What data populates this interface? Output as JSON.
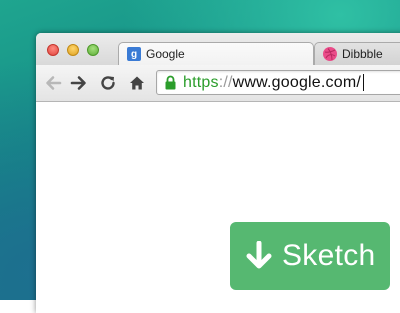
{
  "browser": {
    "tabs": [
      {
        "label": "Google",
        "icon": "google-favicon",
        "active": true
      },
      {
        "label": "Dibbble",
        "icon": "dribbble-favicon",
        "active": false
      }
    ],
    "toolbar": {
      "back_icon": "back-arrow-icon",
      "forward_icon": "forward-arrow-icon",
      "reload_icon": "reload-icon",
      "home_icon": "home-icon"
    },
    "address": {
      "scheme": "https",
      "separator": "://",
      "host": "www.google.com/",
      "secure_icon": "lock-icon",
      "secure_color": "#2b9d2b"
    }
  },
  "overlay": {
    "button_label": "Sketch",
    "button_icon": "download-arrow-icon",
    "button_color": "#56b871"
  }
}
